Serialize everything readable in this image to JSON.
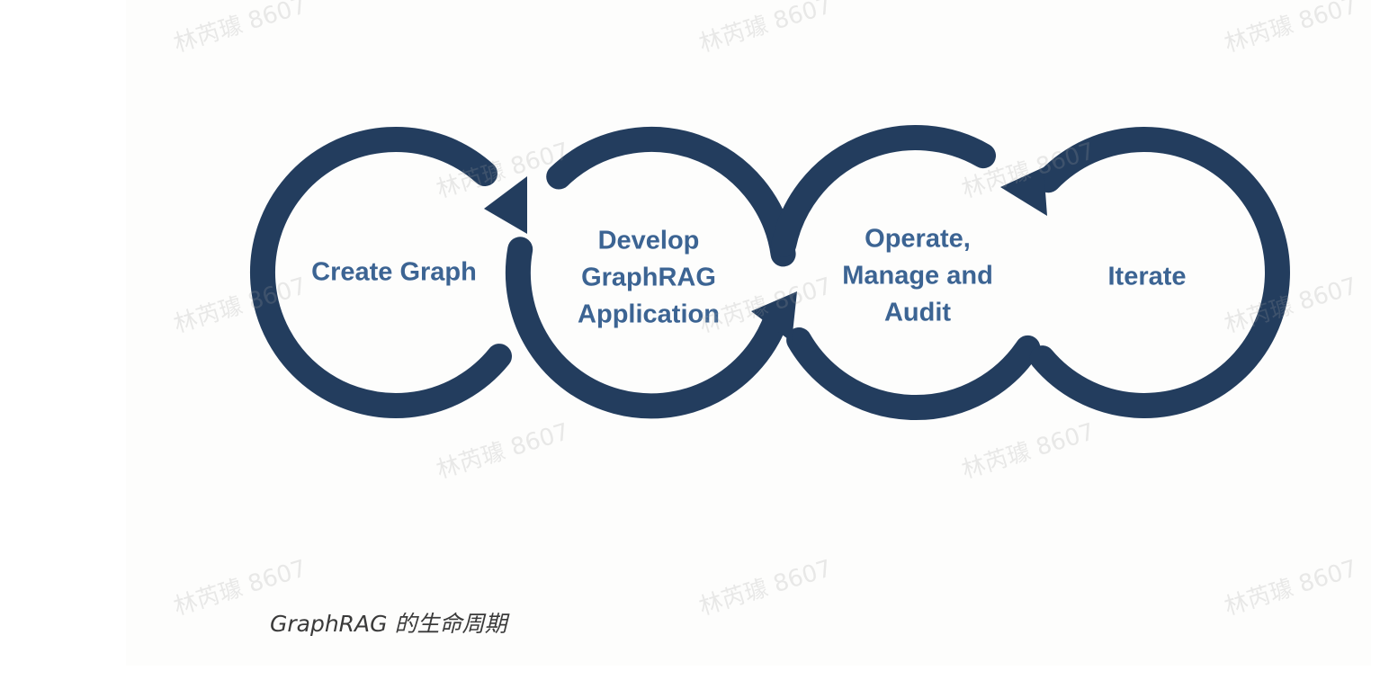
{
  "diagram": {
    "stages": [
      {
        "id": "create",
        "label": "Create Graph"
      },
      {
        "id": "develop",
        "label": "Develop\nGraphRAG\nApplication"
      },
      {
        "id": "operate",
        "label": "Operate,\nManage and\nAudit"
      },
      {
        "id": "iterate",
        "label": "Iterate"
      }
    ],
    "arc_color": "#233d5e",
    "label_color": "#3c6493"
  },
  "caption": "GraphRAG 的生命周期",
  "watermark": "林芮璩 8607"
}
